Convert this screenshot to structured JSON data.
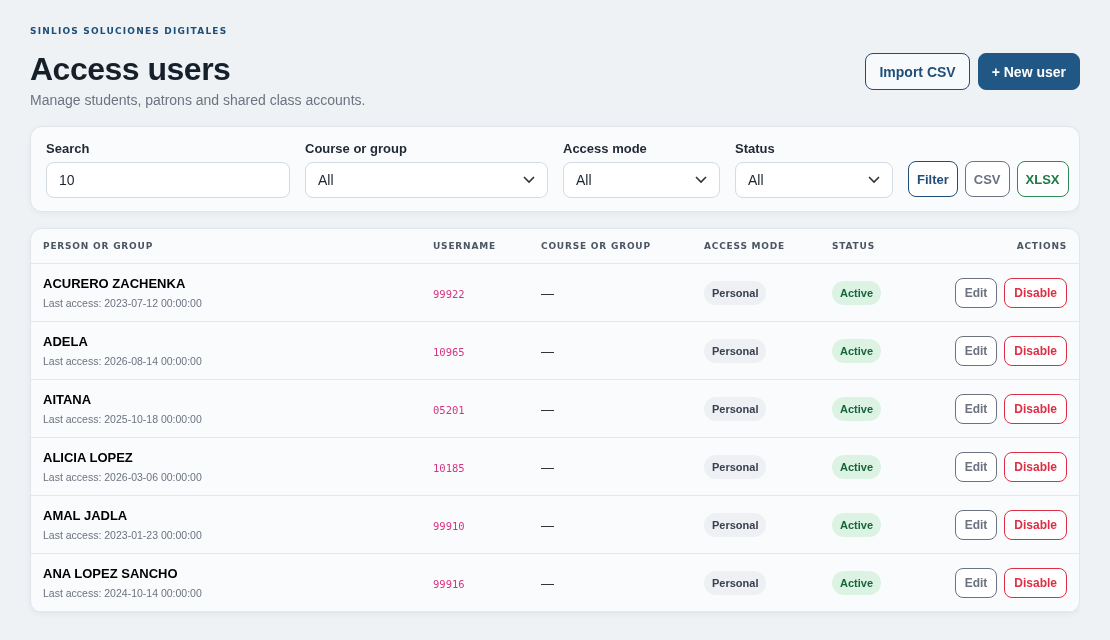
{
  "brand": "SINLIOS SOLUCIONES DIGITALES",
  "title": "Access users",
  "subtitle": "Manage students, patrons and shared class accounts.",
  "header_buttons": [
    {
      "label": "Import CSV",
      "kind": "outline"
    },
    {
      "label": "+ New user",
      "kind": "primary"
    }
  ],
  "filters": [
    {
      "label": "Search",
      "kind": "text",
      "value": "10"
    },
    {
      "label": "Course or group",
      "kind": "select",
      "value": "All"
    },
    {
      "label": "Access mode",
      "kind": "select",
      "value": "All"
    },
    {
      "label": "Status",
      "kind": "select",
      "value": "All"
    }
  ],
  "filter_buttons": [
    {
      "label": "Filter",
      "kind": "primary"
    },
    {
      "label": "CSV",
      "kind": "neutral"
    },
    {
      "label": "XLSX",
      "kind": "success"
    }
  ],
  "table": {
    "columns": [
      "PERSON OR GROUP",
      "USERNAME",
      "COURSE OR GROUP",
      "ACCESS MODE",
      "STATUS",
      "ACTIONS"
    ],
    "rows": [
      {
        "name": "ACURERO ZACHENKA",
        "last_access": "Last access: 2023-07-12 00:00:00",
        "username": "99922",
        "course": "—",
        "access_mode": "Personal",
        "status": {
          "label": "Active",
          "kind": "active"
        },
        "actions": [
          "Edit",
          "Disable"
        ]
      },
      {
        "name": "ADELA",
        "last_access": "Last access: 2026-08-14 00:00:00",
        "username": "10965",
        "course": "—",
        "access_mode": "Personal",
        "status": {
          "label": "Active",
          "kind": "active"
        },
        "actions": [
          "Edit",
          "Disable"
        ]
      },
      {
        "name": "AITANA",
        "last_access": "Last access: 2025-10-18 00:00:00",
        "username": "05201",
        "course": "—",
        "access_mode": "Personal",
        "status": {
          "label": "Active",
          "kind": "active"
        },
        "actions": [
          "Edit",
          "Disable"
        ]
      },
      {
        "name": "ALICIA LOPEZ",
        "last_access": "Last access: 2026-03-06 00:00:00",
        "username": "10185",
        "course": "—",
        "access_mode": "Personal",
        "status": {
          "label": "Active",
          "kind": "active"
        },
        "actions": [
          "Edit",
          "Disable"
        ]
      },
      {
        "name": "AMAL JADLA",
        "last_access": "Last access: 2023-01-23 00:00:00",
        "username": "99910",
        "course": "—",
        "access_mode": "Personal",
        "status": {
          "label": "Active",
          "kind": "active"
        },
        "actions": [
          "Edit",
          "Disable"
        ]
      },
      {
        "name": "ANA LOPEZ SANCHO",
        "last_access": "Last access: 2024-10-14 00:00:00",
        "username": "99916",
        "course": "—",
        "access_mode": "Personal",
        "status": {
          "label": "Active",
          "kind": "active"
        },
        "actions": [
          "Edit",
          "Disable"
        ]
      }
    ]
  }
}
